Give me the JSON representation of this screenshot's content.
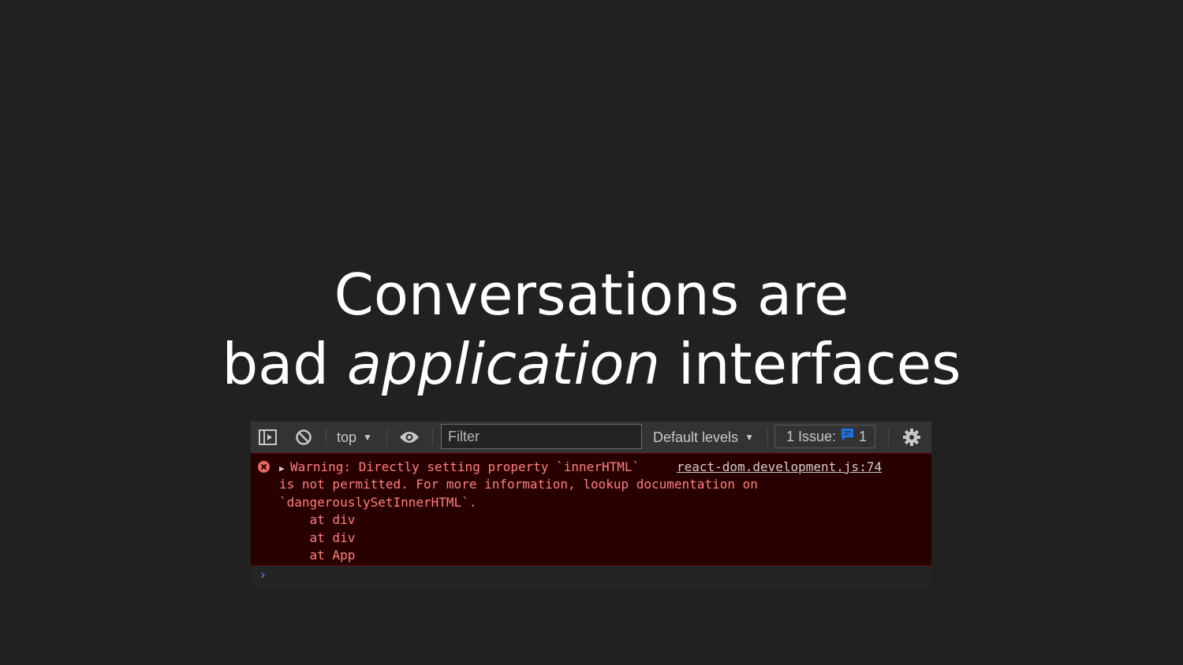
{
  "slide": {
    "title_line1": "Conversations are",
    "title_line2_before": "bad ",
    "title_line2_emphasis": "application",
    "title_line2_after": " interfaces"
  },
  "devtools": {
    "toolbar": {
      "context_label": "top",
      "filter_placeholder": "Filter",
      "levels_label": "Default levels",
      "issues_label": "1 Issue:",
      "issues_count": "1"
    },
    "error": {
      "line1": "Warning: Directly setting property `innerHTML`",
      "source_link": "react-dom.development.js:74",
      "line2": "is not permitted. For more information, lookup documentation on",
      "line3": "`dangerouslySetInnerHTML`.",
      "stack": [
        "    at div",
        "    at div",
        "    at App"
      ]
    },
    "prompt_symbol": "›",
    "colors": {
      "error_bg": "#290000",
      "error_text": "#ff8080",
      "issue_icon": "#1a73e8",
      "toolbar_bg": "#333333"
    }
  }
}
